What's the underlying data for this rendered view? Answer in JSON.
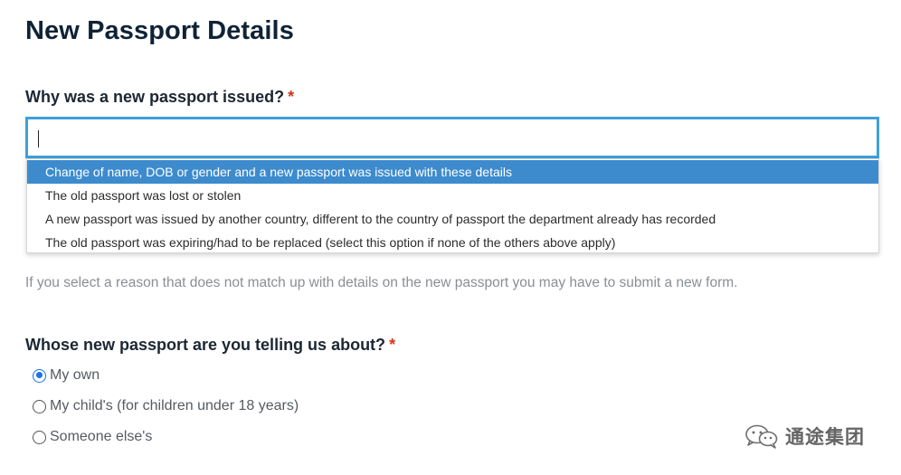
{
  "page": {
    "title": "New Passport Details"
  },
  "question_reason": {
    "label": "Why was a new passport issued?",
    "required_mark": "*",
    "input_value": "",
    "options": [
      "Change of name, DOB or gender and a new passport was issued with these details",
      "The old passport was lost or stolen",
      "A new passport was issued by another country, different to the country of passport the department already has recorded",
      "The old passport was expiring/had to be replaced (select this option if none of the others above apply)"
    ],
    "highlighted_option_index": 0,
    "hint": "If you select a reason that does not match up with details on the new passport you may have to submit a new form."
  },
  "question_whose": {
    "label": "Whose new passport are you telling us about?",
    "required_mark": "*",
    "options": [
      {
        "label": "My own",
        "checked": true
      },
      {
        "label": "My child's (for children under 18 years)",
        "checked": false
      },
      {
        "label": "Someone else's",
        "checked": false
      }
    ]
  },
  "watermark": {
    "text": "通途集团",
    "icon": "wechat-logo-icon"
  },
  "colors": {
    "focus_border": "#3f9fd9",
    "highlight": "#3d8bcd",
    "required": "#d4351c",
    "radio_checked": "#1a73e8"
  }
}
